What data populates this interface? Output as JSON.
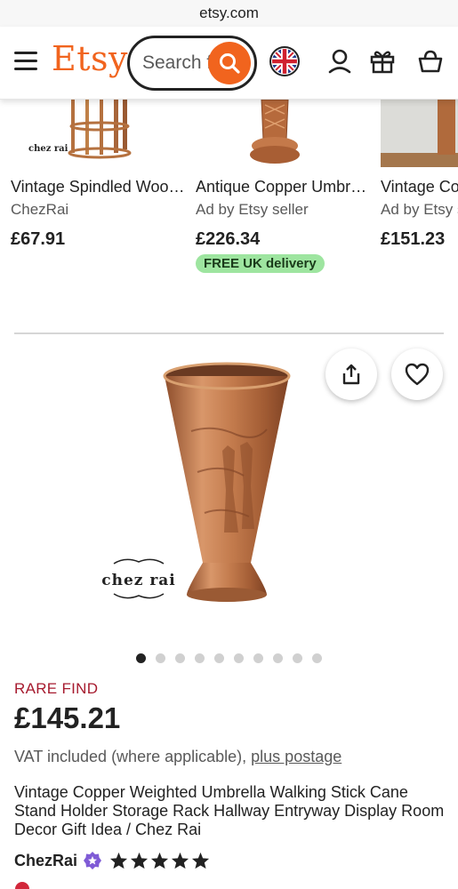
{
  "browser": {
    "url": "etsy.com"
  },
  "header": {
    "logo": "Etsy",
    "search_placeholder": "Search for anything",
    "icons": [
      "menu-icon",
      "search-icon",
      "uk-flag-icon",
      "account-icon",
      "gift-icon",
      "basket-icon"
    ]
  },
  "recommendations": [
    {
      "title": "Vintage Spindled Wooden Stool Plant Stand",
      "seller": "ChezRai",
      "price": "£67.91",
      "badge": ""
    },
    {
      "title": "Antique Copper Umbrella Stand",
      "seller": "Ad by Etsy seller",
      "price": "£226.34",
      "badge": "FREE UK delivery"
    },
    {
      "title": "Vintage Copper Umbrella Stand",
      "seller": "Ad by Etsy seller",
      "price": "£151.23",
      "badge": ""
    }
  ],
  "listing": {
    "watermark": "chez rai",
    "image_count": 10,
    "active_image": 1,
    "rare_label": "RARE FIND",
    "price": "£145.21",
    "vat_text": "VAT included (where applicable),",
    "postage_link": "plus postage",
    "title": "Vintage Copper Weighted Umbrella Walking Stick Cane Stand Holder Storage Rack Hallway Entryway Display Room Decor Gift Idea / Chez Rai",
    "shop_name": "ChezRai",
    "star_rating": 5
  },
  "colors": {
    "brand_orange": "#f1641e",
    "rare_red": "#a61a2e",
    "free_delivery_green": "#9ee5a0",
    "copper": "#c4794a"
  }
}
